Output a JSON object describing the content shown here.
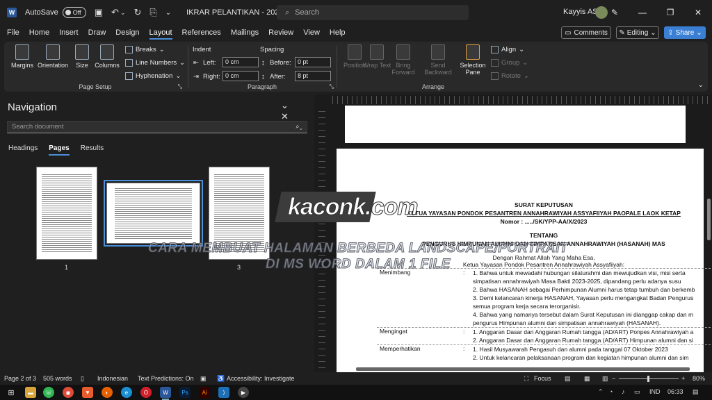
{
  "titlebar": {
    "app_letter": "W",
    "autosave_label": "AutoSave",
    "autosave_state": "Off",
    "doc_title": "IKRAR PELANTIKAN - 2023...",
    "search_placeholder": "Search",
    "user_name": "Kayyis AS"
  },
  "menu": {
    "items": [
      "File",
      "Home",
      "Insert",
      "Draw",
      "Design",
      "Layout",
      "References",
      "Mailings",
      "Review",
      "View",
      "Help"
    ],
    "active": "Layout",
    "comments": "Comments",
    "editing": "Editing",
    "share": "Share"
  },
  "ribbon": {
    "page_setup": {
      "label": "Page Setup",
      "margins": "Margins",
      "orientation": "Orientation",
      "size": "Size",
      "columns": "Columns",
      "breaks": "Breaks",
      "line_numbers": "Line Numbers",
      "hyphenation": "Hyphenation"
    },
    "paragraph": {
      "label": "Paragraph",
      "indent": "Indent",
      "spacing": "Spacing",
      "left_label": "Left:",
      "left_value": "0 cm",
      "right_label": "Right:",
      "right_value": "0 cm",
      "before_label": "Before:",
      "before_value": "0 pt",
      "after_label": "After:",
      "after_value": "8 pt"
    },
    "arrange": {
      "label": "Arrange",
      "position": "Position",
      "wrap_text": "Wrap Text",
      "bring_forward": "Bring Forward",
      "send_backward": "Send Backward",
      "selection_pane": "Selection Pane",
      "align": "Align",
      "group": "Group",
      "rotate": "Rotate"
    }
  },
  "navigation": {
    "title": "Navigation",
    "search_placeholder": "Search document",
    "tabs": [
      "Headings",
      "Pages",
      "Results"
    ],
    "active_tab": "Pages",
    "page_numbers": [
      "1",
      "",
      "3"
    ]
  },
  "document": {
    "heading1": "SURAT KEPUTUSAN",
    "heading2": "KETUA YAYASAN PONDOK PESANTREN ANNAHRAWIYAH ASSYAFIIYAH PAOPALE LAOK KETAP",
    "number": "Nomor : ...../SK/YPP-AA/X/2023",
    "tentang": "TENTANG",
    "subject": "PENGURUS HIMPUNAN ALUMNI DAN SIMPATISAN ANNAHRAWIYAH (HASANAH) MAS",
    "greeting1": "Dengan Rahmat Allah Yang Maha Esa,",
    "greeting2": "Ketua Yayasan Pondok Pesantren Annahrawiyah Assyafiiyah:",
    "rows": [
      {
        "label": "Menimbang",
        "sep": ":",
        "lines": [
          "1.   Bahwa untuk mewadahi hubungan silaturahmi dan mewujudkan visi, misi serta",
          "      simpatisan annahrawiyah Masa Bakti 2023-2025, dipandang perlu adanya susu",
          "2.   Bahwa HASANAH sebagai Perhimpunan Alumni harus tetap tumbuh dan berkemb",
          "3.   Demi kelancaran kinerja HASANAH, Yayasan perlu mengangkat Badan Pengurus",
          "      semua program kerja secara terorganisir.",
          "4.   Bahwa yang namanya tersebut dalam Surat Keputusan ini dianggap cakap dan m",
          "      pengurus Himpunan alumni dan simpatisan annahrawiyah (HASANAH)."
        ]
      },
      {
        "label": "Mengingat",
        "sep": ":",
        "lines": [
          "1.   Anggaran Dasar dan Anggaran Rumah tangga (AD/ART) Ponpes Annahrawiyah a",
          "2.   Anggaran Dasar dan Anggaran Rumah tangga (AD/ART) Himpunan alumni dan si"
        ]
      },
      {
        "label": "Memperhatikan",
        "sep": ":",
        "lines": [
          "1.   Hasil Musyawarah Pengasuh dan alumni pada tanggal 07 Oktober 2023",
          "2.   Untuk kelancaran pelaksanaan program dan kegiatan himpunan alumni dan sim"
        ]
      }
    ]
  },
  "watermark": {
    "logo": "kaconk.com",
    "line1": "CARA MEMBUAT HALAMAN BERBEDA LANDSCAPE/PORTRAIT",
    "line2": "DI MS WORD DALAM 1 FILE"
  },
  "status": {
    "page": "Page 2 of 3",
    "words": "505 words",
    "language": "Indonesian",
    "predictions": "Text Predictions: On",
    "accessibility": "Accessibility: Investigate",
    "focus": "Focus",
    "zoom": "80%"
  },
  "taskbar": {
    "language": "IND",
    "time": "06:33"
  }
}
